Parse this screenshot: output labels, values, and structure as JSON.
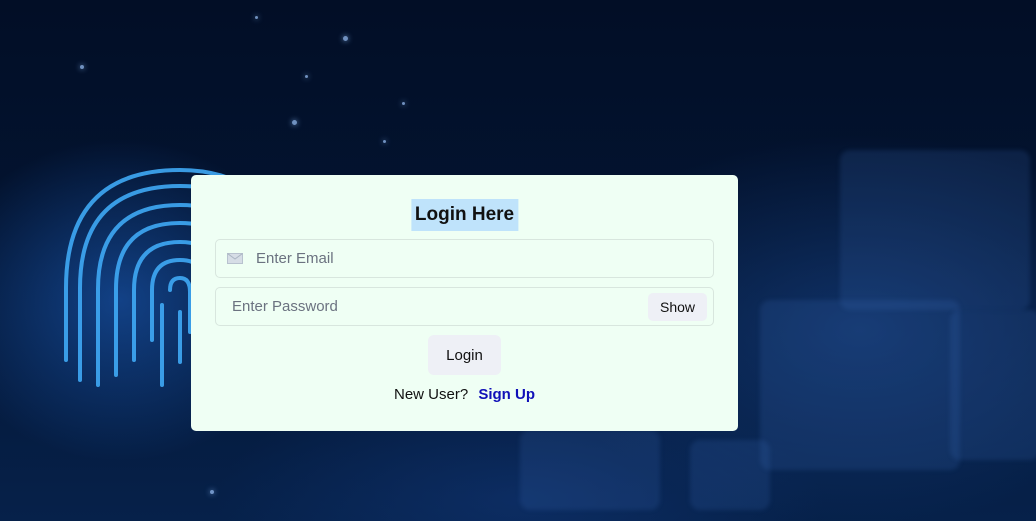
{
  "login_card": {
    "title": "Login Here",
    "email_placeholder": "Enter Email",
    "email_value": "",
    "email_icon": "mail-icon",
    "password_placeholder": "Enter Password",
    "password_value": "",
    "show_label": "Show",
    "login_label": "Login",
    "new_user_text": "New User?",
    "signup_label": "Sign Up"
  },
  "colors": {
    "card_background": "#effff4",
    "title_highlight": "#bfe3fb",
    "button_background": "#eef0f6",
    "link_color": "#1010b8",
    "page_background": "#04112a"
  }
}
